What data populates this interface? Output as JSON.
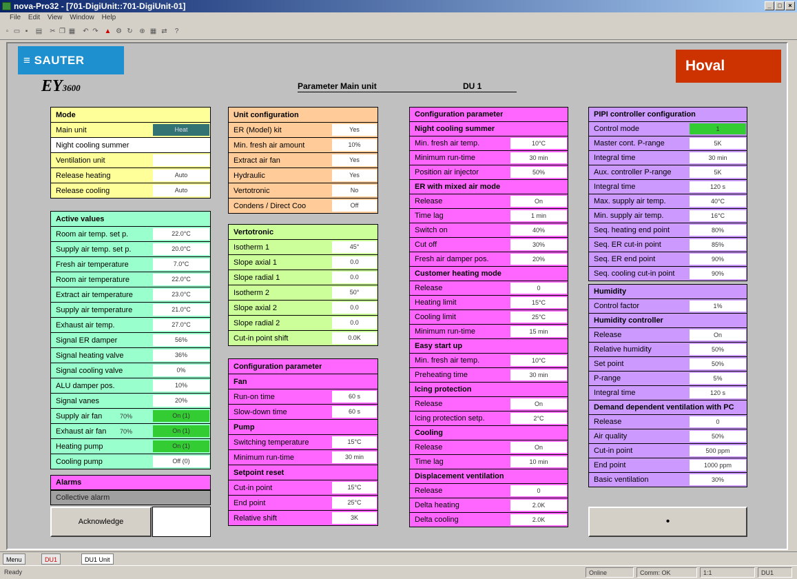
{
  "window": {
    "title": "nova-Pro32 - [701-DigiUnit::701-DigiUnit-01]",
    "menu": [
      "File",
      "Edit",
      "View",
      "Window",
      "Help"
    ]
  },
  "colors": {
    "yellow": "#ffff99",
    "orange": "#ffcc99",
    "green": "#99ffcc",
    "lime": "#ccff99",
    "magenta": "#ff66ff",
    "violet": "#cc99ff",
    "gray": "#a0a0a0",
    "dark_teal": "#337373",
    "bright_green": "#33cc33",
    "sauter_blue": "#1e90d0",
    "hoval_red": "#cc3300"
  },
  "header": {
    "sauter": "SAUTER",
    "ey": "EY",
    "ey_sub": "3600",
    "title": "Parameter Main unit",
    "unit": "DU 1",
    "hoval": "Hoval"
  },
  "mode": {
    "title": "Mode",
    "rows": [
      {
        "label": "Main unit",
        "value": "Heat"
      },
      {
        "label": "Night cooling summer",
        "value": ""
      },
      {
        "label": "Ventilation unit",
        "value": ""
      },
      {
        "label": "Release heating",
        "value": "Auto"
      },
      {
        "label": "Release cooling",
        "value": "Auto"
      }
    ]
  },
  "active": {
    "title": "Active values",
    "rows": [
      {
        "label": "Room air temp. set p.",
        "value": "22.0°C"
      },
      {
        "label": "Supply air temp. set p.",
        "value": "20.0°C"
      },
      {
        "label": "Fresh air temperature",
        "value": "7.0°C"
      },
      {
        "label": "Room air temperature",
        "value": "22.0°C"
      },
      {
        "label": "Extract air temperature",
        "value": "23.0°C"
      },
      {
        "label": "Supply air temperature",
        "value": "21.0°C"
      },
      {
        "label": "Exhaust air temp.",
        "value": "27.0°C"
      },
      {
        "label": "Signal ER damper",
        "value": "56%"
      },
      {
        "label": "Signal heating valve",
        "value": "36%"
      },
      {
        "label": "Signal cooling valve",
        "value": "0%"
      },
      {
        "label": "ALU damper pos.",
        "value": "10%"
      },
      {
        "label": "Signal vanes",
        "value": "20%"
      },
      {
        "label": "Supply air fan",
        "sub": "70%",
        "value": "On (1)"
      },
      {
        "label": "Exhaust air fan",
        "sub": "70%",
        "value": "On (1)"
      },
      {
        "label": "Heating pump",
        "value": "On (1)"
      },
      {
        "label": "Cooling pump",
        "value": "Off (0)"
      }
    ]
  },
  "alarms": {
    "title": "Alarms",
    "collective": "Collective alarm",
    "ack": "Acknowledge"
  },
  "unitcfg": {
    "title": "Unit configuration",
    "rows": [
      {
        "label": "ER (Model) kit",
        "value": "Yes"
      },
      {
        "label": "Min. fresh air amount",
        "value": "10%"
      },
      {
        "label": "Extract air fan",
        "value": "Yes"
      },
      {
        "label": "Hydraulic",
        "value": "Yes"
      },
      {
        "label": "Vertotronic",
        "value": "No"
      },
      {
        "label": "Condens / Direct Coo",
        "value": "Off"
      }
    ]
  },
  "vertotronic": {
    "title": "Vertotronic",
    "rows": [
      {
        "label": "Isotherm 1",
        "value": "45°"
      },
      {
        "label": "Slope axial 1",
        "value": "0.0"
      },
      {
        "label": "Slope radial 1",
        "value": "0.0"
      },
      {
        "label": "Isotherm 2",
        "value": "50°"
      },
      {
        "label": "Slope axial 2",
        "value": "0.0"
      },
      {
        "label": "Slope radial 2",
        "value": "0.0"
      },
      {
        "label": "Cut-in point shift",
        "value": "0.0K"
      }
    ]
  },
  "cfgparam_mid": {
    "title": "Configuration parameter",
    "rows": [
      {
        "label": "Fan",
        "value": null
      },
      {
        "label": "Run-on time",
        "value": "60 s"
      },
      {
        "label": "Slow-down time",
        "value": "60 s"
      },
      {
        "label": "Pump",
        "value": null
      },
      {
        "label": "Switching temperature",
        "value": "15°C"
      },
      {
        "label": "Minimum run-time",
        "value": "30 min"
      },
      {
        "label": "Setpoint reset",
        "value": null
      },
      {
        "label": "Cut-in point",
        "value": "15°C"
      },
      {
        "label": "End point",
        "value": "25°C"
      },
      {
        "label": "Relative shift",
        "value": "3K"
      }
    ]
  },
  "cfgparam_right": {
    "title": "Configuration parameter",
    "rows": [
      {
        "label": "Night cooling summer",
        "value": null
      },
      {
        "label": "Min. fresh air temp.",
        "value": "10°C"
      },
      {
        "label": "Minimum run-time",
        "value": "30 min"
      },
      {
        "label": "Position air injector",
        "value": "50%"
      },
      {
        "label": "ER with mixed air mode",
        "value": null
      },
      {
        "label": "Release",
        "value": "On"
      },
      {
        "label": "Time lag",
        "value": "1 min"
      },
      {
        "label": "Switch on",
        "value": "40%"
      },
      {
        "label": "Cut off",
        "value": "30%"
      },
      {
        "label": "Fresh air damper pos.",
        "value": "20%"
      },
      {
        "label": "Customer heating mode",
        "value": null
      },
      {
        "label": "Release",
        "value": "0"
      },
      {
        "label": "Heating limit",
        "value": "15°C"
      },
      {
        "label": "Cooling limit",
        "value": "25°C"
      },
      {
        "label": "Minimum run-time",
        "value": "15 min"
      },
      {
        "label": "Easy start up",
        "value": null
      },
      {
        "label": "Min. fresh air temp.",
        "value": "10°C"
      },
      {
        "label": "Preheating time",
        "value": "30 min"
      },
      {
        "label": "Icing protection",
        "value": null
      },
      {
        "label": "Release",
        "value": "On"
      },
      {
        "label": "Icing protection setp.",
        "value": "2°C"
      },
      {
        "label": "Cooling",
        "value": null
      },
      {
        "label": "Release",
        "value": "On"
      },
      {
        "label": "Time lag",
        "value": "10 min"
      },
      {
        "label": "Displacement ventilation",
        "value": null
      },
      {
        "label": "Release",
        "value": "0"
      },
      {
        "label": "Delta heating",
        "value": "2.0K"
      },
      {
        "label": "Delta cooling",
        "value": "2.0K"
      }
    ]
  },
  "pipi": {
    "title": "PIPI controller configuration",
    "rows": [
      {
        "label": "Control mode",
        "value": "1"
      },
      {
        "label": "Master cont. P-range",
        "value": "5K"
      },
      {
        "label": "Integral time",
        "value": "30 min"
      },
      {
        "label": "Aux. controller P-range",
        "value": "5K"
      },
      {
        "label": "Integral time",
        "value": "120 s"
      },
      {
        "label": "Max. supply air temp.",
        "value": "40°C"
      },
      {
        "label": "Min. supply air temp.",
        "value": "16°C"
      },
      {
        "label": "Seq. heating end point",
        "value": "80%"
      },
      {
        "label": "Seq. ER cut-in point",
        "value": "85%"
      },
      {
        "label": "Seq. ER end point",
        "value": "90%"
      },
      {
        "label": "Seq. cooling cut-in point",
        "value": "90%"
      }
    ]
  },
  "humidity": {
    "title": "Humidity",
    "rows": [
      {
        "label": "Control factor",
        "value": "1%"
      },
      {
        "label": "Humidity controller",
        "value": null
      },
      {
        "label": "Release",
        "value": "On"
      },
      {
        "label": "Relative humidity",
        "value": "50%"
      },
      {
        "label": "Set point",
        "value": "50%"
      },
      {
        "label": "P-range",
        "value": "5%"
      },
      {
        "label": "Integral time",
        "value": "120 s"
      },
      {
        "label": "Demand dependent ventilation with PC",
        "value": null
      },
      {
        "label": "Release",
        "value": "0"
      },
      {
        "label": "Air quality",
        "value": "50%"
      },
      {
        "label": "Cut-in point",
        "value": "500 ppm"
      },
      {
        "label": "End point",
        "value": "1000 ppm"
      },
      {
        "label": "Basic ventilation",
        "value": "30%"
      }
    ]
  },
  "right_button": {
    "label": "•"
  },
  "tabs": [
    "Menu",
    "DU1",
    "DU1 Unit"
  ],
  "status": {
    "left": "Ready",
    "fields": [
      "Online",
      "Comm: OK",
      "1:1",
      "DU1"
    ]
  }
}
